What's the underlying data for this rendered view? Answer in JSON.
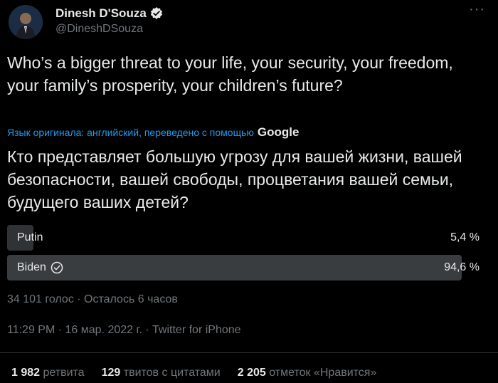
{
  "author": {
    "name": "Dinesh D'Souza",
    "handle": "@DineshDSouza"
  },
  "tweet": {
    "text": "Who’s a bigger threat to your life, your security, your freedom, your family’s prosperity, your children’s future?",
    "translated_note": "Язык оригинала: английский, переведено с помощью",
    "translator_brand": "Google",
    "translation": "Кто представляет большую угрозу для вашей жизни, вашей безопасности, вашей свободы, процветания вашей семьи, будущего ваших детей?"
  },
  "poll": {
    "options": [
      {
        "label": "Putin",
        "percent_text": "5,4 %",
        "percent": 5.4,
        "winner": false
      },
      {
        "label": "Biden",
        "percent_text": "94,6 %",
        "percent": 94.6,
        "winner": true
      }
    ],
    "meta": "34 101 голос · Осталось 6 часов"
  },
  "timestamp": "11:29 PM · 16 мар. 2022 г. · Twitter for iPhone",
  "stats": {
    "retweets_count": "1 982",
    "retweets_label": "ретвита",
    "quotes_count": "129",
    "quotes_label": "твитов с цитатами",
    "likes_count": "2 205",
    "likes_label": "отметок «Нравится»"
  },
  "icons": {
    "verified": "verified-badge-icon",
    "more": "more-options-icon",
    "check": "check-circle-icon"
  },
  "colors": {
    "background": "#000000",
    "text": "#e7e9ea",
    "secondary": "#71767b",
    "link": "#1d9bf0",
    "poll_bar": "#2f3336"
  }
}
